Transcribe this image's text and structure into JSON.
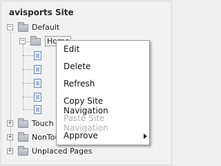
{
  "site": {
    "title": "avisports Site"
  },
  "tree": {
    "default": {
      "label": "Default",
      "expander": "−"
    },
    "home": {
      "label": "Home",
      "expander": "−"
    },
    "touch": {
      "label": "Touch",
      "expander": "+"
    },
    "nontouch": {
      "label": "NonTouch",
      "expander": "+"
    },
    "unplaced": {
      "label": "Unplaced Pages",
      "expander": "+"
    }
  },
  "context_menu": {
    "items": [
      {
        "label": "Edit",
        "enabled": true
      },
      {
        "label": "Delete",
        "enabled": true
      },
      {
        "label": "Refresh",
        "enabled": true
      },
      {
        "label": "Copy Site Navigation",
        "enabled": true
      },
      {
        "label": "Paste Site Navigation",
        "enabled": false
      },
      {
        "label": "Approve",
        "enabled": true,
        "has_submenu": true
      }
    ]
  },
  "icons": {
    "folder": "folder-icon",
    "page": "page-icon",
    "submenu": "submenu-arrow-icon"
  },
  "colors": {
    "background": "#f0f0f0",
    "menu_background": "#ffffff",
    "disabled_text": "#b2b2b2",
    "page_icon_border": "#6b89ad"
  }
}
